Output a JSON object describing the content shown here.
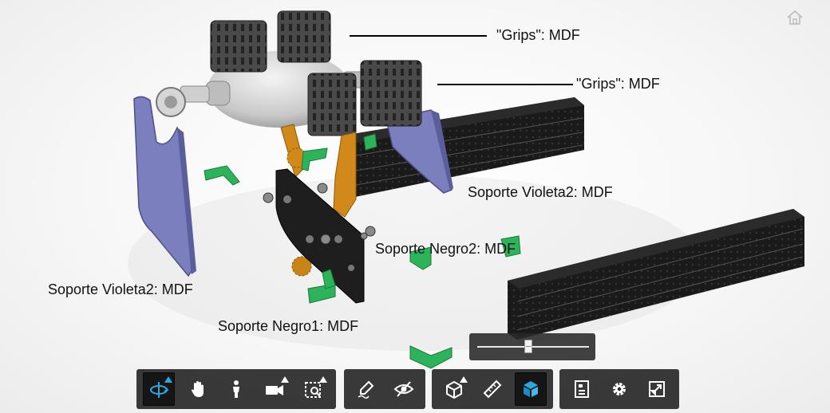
{
  "viewer": {
    "callouts": [
      {
        "text": "\"Grips\": MDF"
      },
      {
        "text": "\"Grips\": MDF"
      },
      {
        "text": "Soporte Violeta2: MDF"
      },
      {
        "text": "Soporte Negro2: MDF"
      },
      {
        "text": "Soporte Violeta2: MDF"
      },
      {
        "text": "Soporte Negro1: MDF"
      }
    ],
    "colors": {
      "violet_plate": "#7b7fbd",
      "black_parts": "#1e1e1e",
      "green_brackets": "#2db35a",
      "orange_gears": "#d18a1a",
      "grip_gray": "#4a4a4a",
      "bulb_gray": "#cfcfcf",
      "toolbar_bg": "#282828",
      "active_icon": "#2aa8e0"
    },
    "explode_slider": {
      "value": 0.46
    }
  },
  "toolbar": {
    "groups": [
      {
        "name": "navigation",
        "tools": [
          {
            "icon": "orbit-icon",
            "active": true
          },
          {
            "icon": "pan-icon",
            "active": false
          },
          {
            "icon": "first-person-icon",
            "active": false
          },
          {
            "icon": "camera-icon",
            "active": false
          },
          {
            "icon": "fit-to-view-icon",
            "active": false
          }
        ]
      },
      {
        "name": "review",
        "tools": [
          {
            "icon": "markup-pen-icon",
            "active": false
          },
          {
            "icon": "hide-eye-icon",
            "active": false
          }
        ]
      },
      {
        "name": "model",
        "tools": [
          {
            "icon": "section-box-icon",
            "active": false
          },
          {
            "icon": "measure-ruler-icon",
            "active": false
          },
          {
            "icon": "explode-cube-icon",
            "active": true
          }
        ]
      },
      {
        "name": "settings",
        "tools": [
          {
            "icon": "model-browser-icon",
            "active": false
          },
          {
            "icon": "settings-gear-icon",
            "active": false
          },
          {
            "icon": "fullscreen-icon",
            "active": false
          }
        ]
      }
    ]
  }
}
